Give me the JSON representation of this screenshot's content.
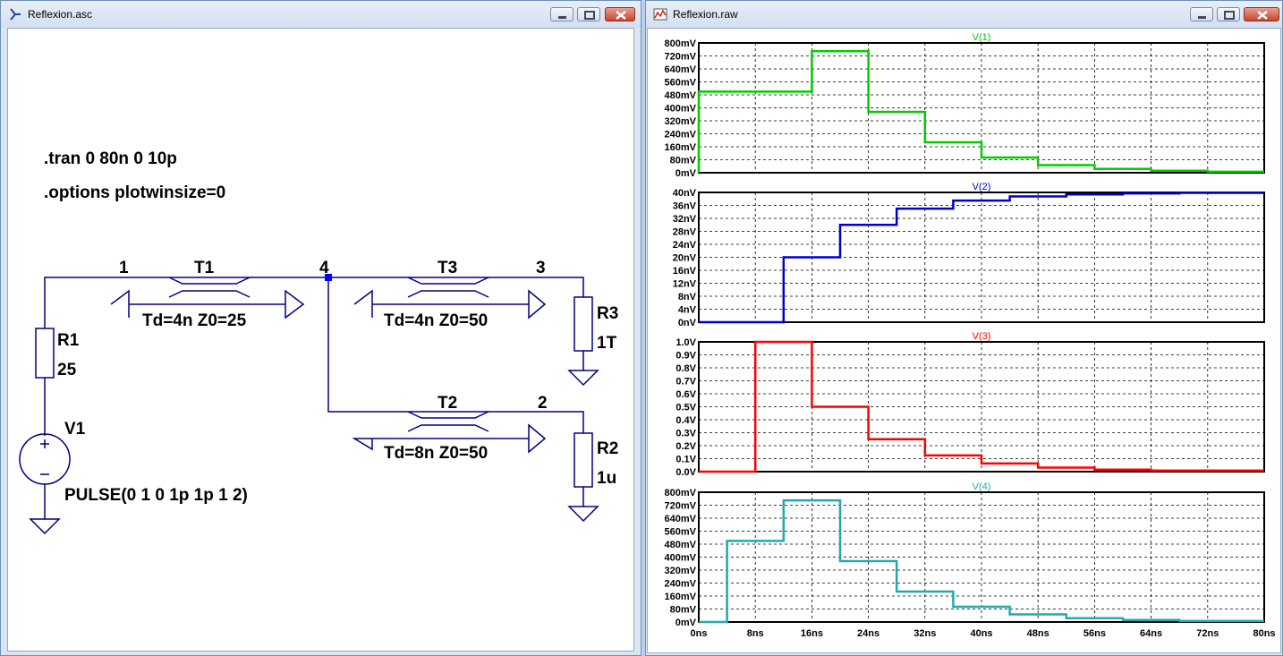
{
  "left_window": {
    "title": "Reflexion.asc",
    "schematic": {
      "directives": [
        ".tran 0 80n 0 10p",
        ".options plotwinsize=0"
      ],
      "nodes": [
        "1",
        "4",
        "3",
        "2"
      ],
      "t1": {
        "name": "T1",
        "params": "Td=4n Z0=25"
      },
      "t3": {
        "name": "T3",
        "params": "Td=4n Z0=50"
      },
      "t2": {
        "name": "T2",
        "params": "Td=8n Z0=50"
      },
      "r1": {
        "name": "R1",
        "value": "25"
      },
      "r3": {
        "name": "R3",
        "value": "1T"
      },
      "r2": {
        "name": "R2",
        "value": "1u"
      },
      "v1": {
        "name": "V1",
        "value": "PULSE(0 1 0 1p 1p 1 2)"
      },
      "wire_color": "#000080",
      "junction_color": "#0000ff"
    }
  },
  "right_window": {
    "title": "Reflexion.raw",
    "x_ticks": [
      "0ns",
      "8ns",
      "16ns",
      "24ns",
      "32ns",
      "40ns",
      "48ns",
      "56ns",
      "64ns",
      "72ns",
      "80ns"
    ],
    "panes": [
      {
        "trace": "V(1)",
        "color": "#00cc00",
        "yticks": [
          "800mV",
          "720mV",
          "640mV",
          "560mV",
          "480mV",
          "400mV",
          "320mV",
          "240mV",
          "160mV",
          "80mV",
          "0mV"
        ],
        "ymax": 0.8,
        "points": [
          [
            0,
            0
          ],
          [
            0,
            0.5
          ],
          [
            16,
            0.5
          ],
          [
            16,
            0.75
          ],
          [
            24,
            0.75
          ],
          [
            24,
            0.375
          ],
          [
            32,
            0.375
          ],
          [
            32,
            0.1875
          ],
          [
            40,
            0.1875
          ],
          [
            40,
            0.094
          ],
          [
            48,
            0.094
          ],
          [
            48,
            0.047
          ],
          [
            56,
            0.047
          ],
          [
            56,
            0.023
          ],
          [
            64,
            0.023
          ],
          [
            64,
            0.012
          ],
          [
            72,
            0.012
          ],
          [
            72,
            0.006
          ],
          [
            80,
            0.006
          ]
        ]
      },
      {
        "trace": "V(2)",
        "color": "#0000cc",
        "yticks": [
          "40nV",
          "36nV",
          "32nV",
          "28nV",
          "24nV",
          "20nV",
          "16nV",
          "12nV",
          "8nV",
          "4nV",
          "0nV"
        ],
        "ymax": 40,
        "points": [
          [
            0,
            0
          ],
          [
            12,
            0
          ],
          [
            12,
            20
          ],
          [
            20,
            20
          ],
          [
            20,
            30
          ],
          [
            28,
            30
          ],
          [
            28,
            35
          ],
          [
            36,
            35
          ],
          [
            36,
            37.5
          ],
          [
            44,
            37.5
          ],
          [
            44,
            38.75
          ],
          [
            52,
            38.75
          ],
          [
            52,
            39.4
          ],
          [
            60,
            39.4
          ],
          [
            60,
            39.7
          ],
          [
            68,
            39.7
          ],
          [
            68,
            39.85
          ],
          [
            80,
            39.85
          ]
        ]
      },
      {
        "trace": "V(3)",
        "color": "#ff0000",
        "yticks": [
          "1.0V",
          "0.9V",
          "0.8V",
          "0.7V",
          "0.6V",
          "0.5V",
          "0.4V",
          "0.3V",
          "0.2V",
          "0.1V",
          "0.0V"
        ],
        "ymax": 1.0,
        "points": [
          [
            0,
            0
          ],
          [
            8,
            0
          ],
          [
            8,
            1.0
          ],
          [
            16,
            1.0
          ],
          [
            16,
            0.5
          ],
          [
            24,
            0.5
          ],
          [
            24,
            0.25
          ],
          [
            32,
            0.25
          ],
          [
            32,
            0.125
          ],
          [
            40,
            0.125
          ],
          [
            40,
            0.0625
          ],
          [
            48,
            0.0625
          ],
          [
            48,
            0.031
          ],
          [
            56,
            0.031
          ],
          [
            56,
            0.016
          ],
          [
            64,
            0.016
          ],
          [
            64,
            0.008
          ],
          [
            80,
            0.008
          ]
        ]
      },
      {
        "trace": "V(4)",
        "color": "#22aaaa",
        "yticks": [
          "800mV",
          "720mV",
          "640mV",
          "560mV",
          "480mV",
          "400mV",
          "320mV",
          "240mV",
          "160mV",
          "80mV",
          "0mV"
        ],
        "ymax": 0.8,
        "points": [
          [
            0,
            0
          ],
          [
            4,
            0
          ],
          [
            4,
            0.5
          ],
          [
            12,
            0.5
          ],
          [
            12,
            0.75
          ],
          [
            20,
            0.75
          ],
          [
            20,
            0.375
          ],
          [
            28,
            0.375
          ],
          [
            28,
            0.1875
          ],
          [
            36,
            0.1875
          ],
          [
            36,
            0.094
          ],
          [
            44,
            0.094
          ],
          [
            44,
            0.047
          ],
          [
            52,
            0.047
          ],
          [
            52,
            0.023
          ],
          [
            60,
            0.023
          ],
          [
            60,
            0.012
          ],
          [
            68,
            0.012
          ],
          [
            68,
            0.006
          ],
          [
            80,
            0.006
          ]
        ]
      }
    ]
  }
}
